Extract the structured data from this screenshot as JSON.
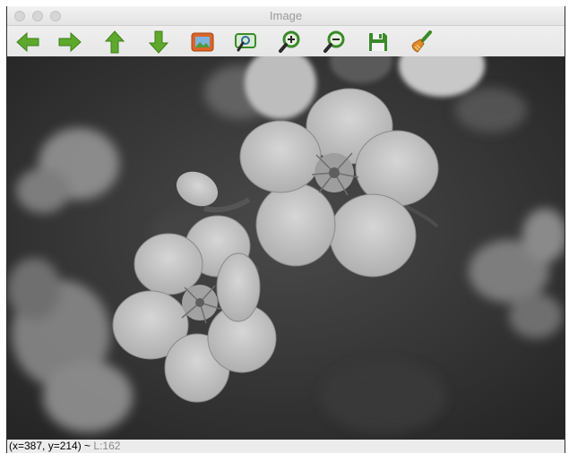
{
  "window": {
    "title": "Image"
  },
  "toolbar": {
    "buttons": [
      {
        "name": "pan-left-button",
        "icon": "arrow-left-icon",
        "color": "#5ea82b"
      },
      {
        "name": "pan-right-button",
        "icon": "arrow-right-icon",
        "color": "#5ea82b"
      },
      {
        "name": "pan-up-button",
        "icon": "arrow-up-icon",
        "color": "#5ea82b"
      },
      {
        "name": "pan-down-button",
        "icon": "arrow-down-icon",
        "color": "#5ea82b"
      },
      {
        "name": "fit-image-button",
        "icon": "picture-frame-icon",
        "color": "#d9662b"
      },
      {
        "name": "zoom-region-button",
        "icon": "zoom-region-icon",
        "color": "#3a8a2a"
      },
      {
        "name": "zoom-in-button",
        "icon": "zoom-in-icon",
        "color": "#3a8a2a"
      },
      {
        "name": "zoom-out-button",
        "icon": "zoom-out-icon",
        "color": "#3a8a2a"
      },
      {
        "name": "save-button",
        "icon": "floppy-disk-icon",
        "color": "#3a8a2a"
      },
      {
        "name": "properties-button",
        "icon": "brush-icon",
        "color": "#e08a2a"
      }
    ]
  },
  "canvas": {
    "content": "grayscale-photo-cherry-blossoms"
  },
  "status": {
    "coords": "(x=387, y=214) ~",
    "level": " L:162"
  }
}
